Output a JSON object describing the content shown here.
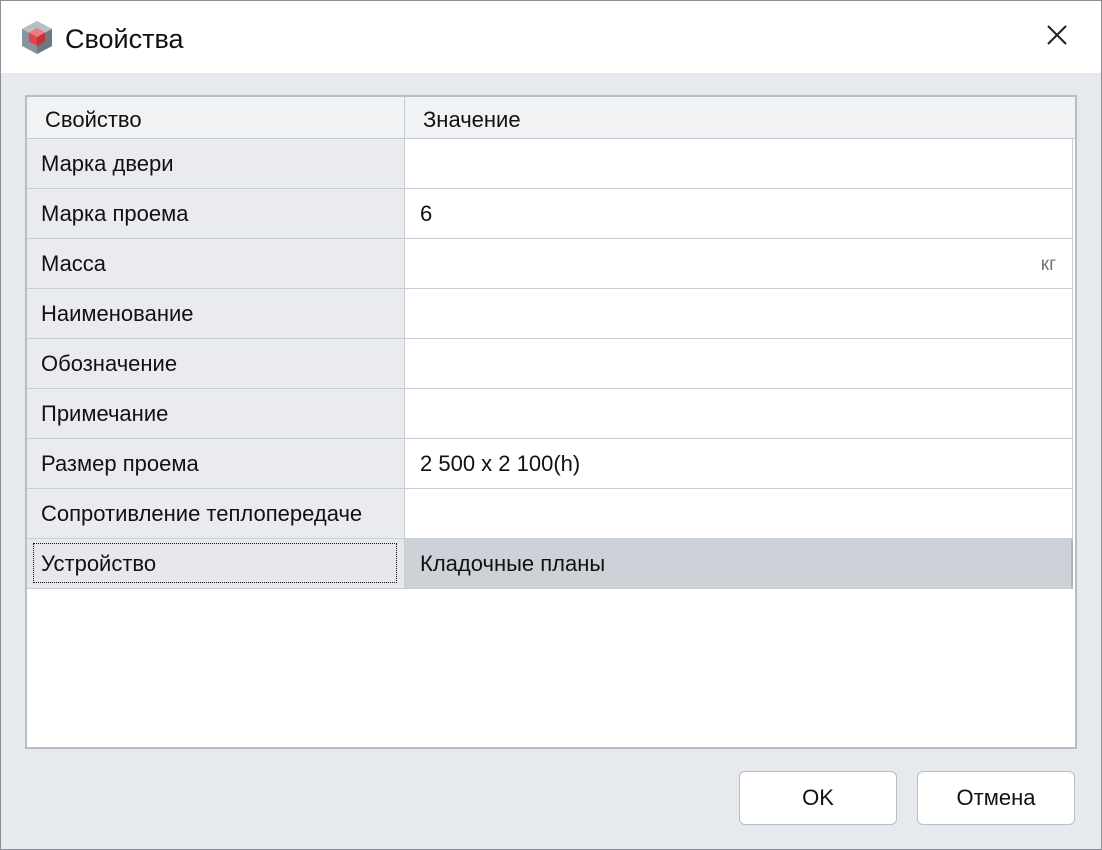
{
  "window": {
    "title": "Свойства",
    "icon": "cube-icon",
    "close_icon": "close-icon"
  },
  "grid": {
    "columns": [
      "Свойство",
      "Значение"
    ],
    "rows": [
      {
        "name": "Марка двери",
        "value": "",
        "unit": ""
      },
      {
        "name": "Марка проема",
        "value": "6",
        "unit": ""
      },
      {
        "name": "Масса",
        "value": "",
        "unit": "кг"
      },
      {
        "name": "Наименование",
        "value": "",
        "unit": ""
      },
      {
        "name": "Обозначение",
        "value": "",
        "unit": ""
      },
      {
        "name": "Примечание",
        "value": "",
        "unit": ""
      },
      {
        "name": "Размер проема",
        "value": "2 500 x 2 100(h)",
        "unit": ""
      },
      {
        "name": "Сопротивление теплопередаче",
        "value": "",
        "unit": ""
      },
      {
        "name": "Устройство",
        "value": "Кладочные планы",
        "unit": ""
      }
    ],
    "selected_row": 8
  },
  "buttons": {
    "ok": "OK",
    "cancel": "Отмена"
  },
  "colors": {
    "accent_icon": "#e0454b",
    "selection": "#cdd2d8"
  }
}
